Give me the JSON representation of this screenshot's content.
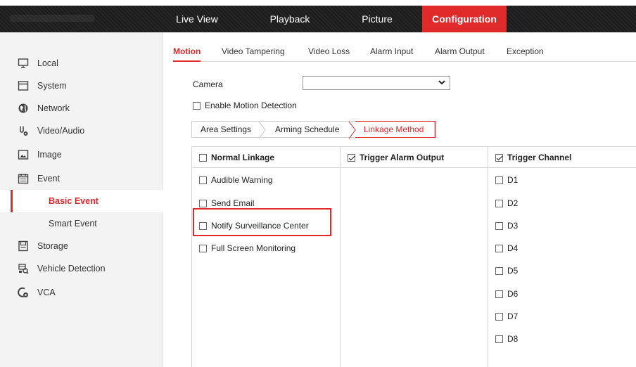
{
  "top_nav": {
    "items": [
      {
        "label": "Live View",
        "active": false
      },
      {
        "label": "Playback",
        "active": false
      },
      {
        "label": "Picture",
        "active": false
      },
      {
        "label": "Configuration",
        "active": true
      }
    ]
  },
  "sidebar": {
    "items": [
      {
        "label": "Local",
        "icon": "monitor-icon"
      },
      {
        "label": "System",
        "icon": "system-icon"
      },
      {
        "label": "Network",
        "icon": "globe-icon"
      },
      {
        "label": "Video/Audio",
        "icon": "video-audio-icon"
      },
      {
        "label": "Image",
        "icon": "image-icon"
      },
      {
        "label": "Event",
        "icon": "calendar-icon"
      },
      {
        "label": "Basic Event",
        "sub": true,
        "active": true
      },
      {
        "label": "Smart Event",
        "sub": true
      },
      {
        "label": "Storage",
        "icon": "storage-icon"
      },
      {
        "label": "Vehicle Detection",
        "icon": "vehicle-icon"
      },
      {
        "label": "VCA",
        "icon": "vca-icon"
      }
    ]
  },
  "tabs": [
    "Motion",
    "Video Tampering",
    "Video Loss",
    "Alarm Input",
    "Alarm Output",
    "Exception"
  ],
  "active_tab": "Motion",
  "camera": {
    "label": "Camera",
    "value": ""
  },
  "enable_motion": {
    "label": "Enable Motion Detection",
    "checked": false
  },
  "steps": [
    "Area Settings",
    "Arming Schedule",
    "Linkage Method"
  ],
  "active_step": "Linkage Method",
  "linkage": {
    "normal": {
      "header": "Normal Linkage",
      "checked": false,
      "items": [
        {
          "label": "Audible Warning",
          "checked": false
        },
        {
          "label": "Send Email",
          "checked": false
        },
        {
          "label": "Notify Surveillance Center",
          "checked": false
        },
        {
          "label": "Full Screen Monitoring",
          "checked": false
        }
      ]
    },
    "alarm_output": {
      "header": "Trigger Alarm Output",
      "checked": true
    },
    "trigger_channel": {
      "header": "Trigger Channel",
      "checked": true,
      "items": [
        {
          "label": "D1",
          "checked": false
        },
        {
          "label": "D2",
          "checked": false
        },
        {
          "label": "D3",
          "checked": false
        },
        {
          "label": "D4",
          "checked": false
        },
        {
          "label": "D5",
          "checked": false
        },
        {
          "label": "D6",
          "checked": false
        },
        {
          "label": "D7",
          "checked": false
        },
        {
          "label": "D8",
          "checked": false
        }
      ]
    }
  },
  "colors": {
    "accent": "#e02a2a",
    "topbar": "#222222",
    "sidebar_bg": "#f3f3f3"
  }
}
